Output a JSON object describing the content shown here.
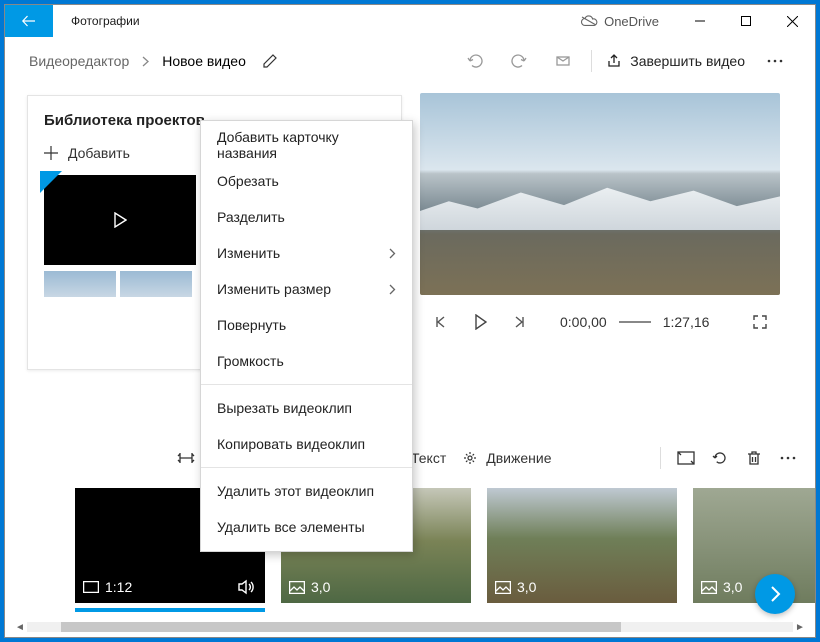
{
  "app_title": "Фотографии",
  "onedrive_label": "OneDrive",
  "breadcrumb": {
    "root": "Видеоредактор",
    "current": "Новое видео"
  },
  "toolbar": {
    "finish_label": "Завершить видео"
  },
  "library": {
    "title": "Библиотека проектов",
    "add_label": "Добавить"
  },
  "playback": {
    "current": "0:00,00",
    "total": "1:27,16"
  },
  "context_menu": [
    "Добавить карточку названия",
    "Обрезать",
    "Разделить",
    "Изменить",
    "Изменить размер",
    "Повернуть",
    "Громкость",
    "—",
    "Вырезать видеоклип",
    "Копировать видеоклип",
    "—",
    "Удалить этот видеоклип",
    "Удалить все элементы"
  ],
  "context_submenu_indices": [
    3,
    4
  ],
  "lowtool": {
    "text": "Текст",
    "motion": "Движение"
  },
  "clips": [
    {
      "badge": "1:12",
      "icon": "aspect"
    },
    {
      "badge": "3,0",
      "icon": "image"
    },
    {
      "badge": "3,0",
      "icon": "image"
    },
    {
      "badge": "3,0",
      "icon": "image"
    }
  ]
}
